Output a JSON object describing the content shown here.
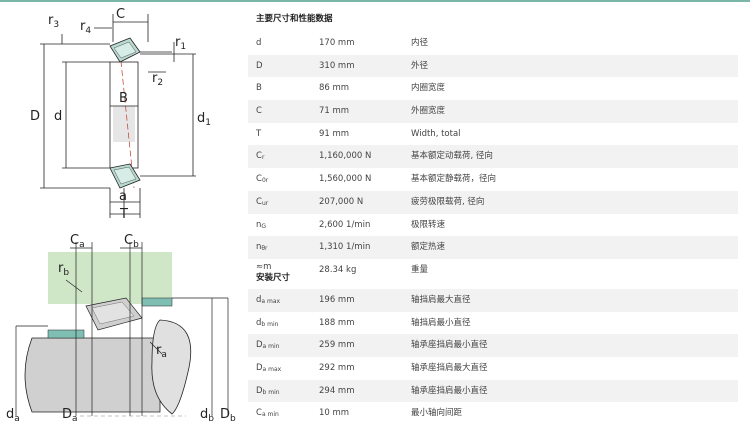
{
  "diagram": {
    "top_labels": {
      "r3": "r3",
      "r4": "r4",
      "C": "C",
      "r1": "r1",
      "r2": "r2",
      "B": "B",
      "D": "D",
      "d": "d",
      "d1": "d1",
      "a": "a",
      "T": "T"
    },
    "bottom_labels": {
      "Ca": "Ca",
      "Cb": "Cb",
      "rb": "rb",
      "ra": "ra",
      "da": "da",
      "Da": "Da",
      "db": "db",
      "Db": "Db"
    }
  },
  "table": {
    "section1_title": "主要尺寸和性能数据",
    "rows": [
      {
        "sym": "d",
        "sub": "",
        "value": "170 mm",
        "desc": "内径"
      },
      {
        "sym": "D",
        "sub": "",
        "value": "310 mm",
        "desc": "外径"
      },
      {
        "sym": "B",
        "sub": "",
        "value": "86 mm",
        "desc": "内圈宽度"
      },
      {
        "sym": "C",
        "sub": "",
        "value": "71 mm",
        "desc": "外圈宽度"
      },
      {
        "sym": "T",
        "sub": "",
        "value": "91 mm",
        "desc": "Width, total"
      },
      {
        "sym": "C",
        "sub": "r",
        "value": "1,160,000 N",
        "desc": "基本额定动载荷, 径向"
      },
      {
        "sym": "C",
        "sub": "0r",
        "value": "1,560,000 N",
        "desc": "基本额定静载荷，径向"
      },
      {
        "sym": "C",
        "sub": "ur",
        "value": "207,000 N",
        "desc": "疲劳极限载荷, 径向"
      },
      {
        "sym": "n",
        "sub": "G",
        "value": "2,600 1/min",
        "desc": "极限转速"
      },
      {
        "sym": "n",
        "sub": "θr",
        "value": "1,310 1/min",
        "desc": "额定热速"
      }
    ],
    "mass_row": {
      "sym": "≈m",
      "section2_title": "安装尺寸",
      "value": "28.34 kg",
      "desc": "重量"
    },
    "rows2": [
      {
        "sym": "d",
        "sub": "a max",
        "value": "196 mm",
        "desc": "轴挡肩最大直径"
      },
      {
        "sym": "d",
        "sub": "b min",
        "value": "188 mm",
        "desc": "轴挡肩最小直径"
      },
      {
        "sym": "D",
        "sub": "a min",
        "value": "259 mm",
        "desc": "轴承座挡肩最小直径"
      },
      {
        "sym": "D",
        "sub": "a max",
        "value": "292 mm",
        "desc": "轴承座挡肩最大直径"
      },
      {
        "sym": "D",
        "sub": "b min",
        "value": "294 mm",
        "desc": "轴承座挡肩最小直径"
      },
      {
        "sym": "C",
        "sub": "a min",
        "value": "10 mm",
        "desc": "最小轴向间距"
      }
    ]
  }
}
